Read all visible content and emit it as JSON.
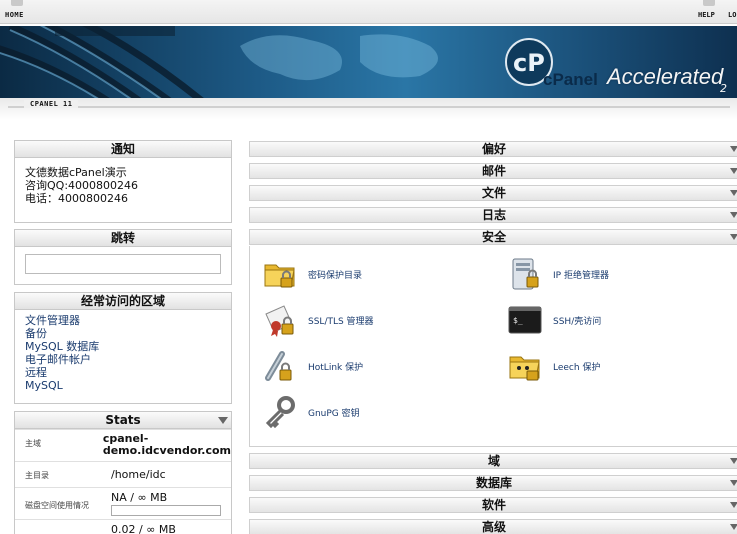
{
  "topbar": {
    "home": "HOME",
    "help": "HELP",
    "logout": "LO"
  },
  "banner": {
    "cpanel": "cPanel",
    "accelerated": "Accelerated",
    "version": "2"
  },
  "breadcrumb": "CPANEL 11",
  "notice": {
    "title": "通知",
    "lines": [
      "文德数据cPanel演示",
      "咨询QQ:4000800246",
      "电话：4000800246"
    ]
  },
  "jump": {
    "title": "跳转",
    "value": ""
  },
  "favorites": {
    "title": "经常访问的区域",
    "items": [
      "文件管理器",
      "备份",
      "MySQL 数据库",
      "电子邮件帐户",
      "远程",
      "MySQL"
    ]
  },
  "stats": {
    "title": "Stats",
    "rows": [
      {
        "key": "主域",
        "value": "cpanel-demo.idcvendor.com"
      },
      {
        "key": "主目录",
        "value": "/home/idc"
      },
      {
        "key": "磁盘空间使用情况",
        "value": "NA / ∞ MB"
      },
      {
        "key": "",
        "value": "0.02 / ∞ MB"
      }
    ]
  },
  "sections": {
    "preferences": "偏好",
    "mail": "邮件",
    "files": "文件",
    "logs": "日志",
    "security": "安全",
    "domains": "域",
    "databases": "数据库",
    "software": "软件",
    "advanced": "高级"
  },
  "security_items": [
    {
      "label": "密码保护目录",
      "icon": "folder-lock-icon"
    },
    {
      "label": "IP 拒绝管理器",
      "icon": "server-deny-icon"
    },
    {
      "label": "SSL/TLS 管理器",
      "icon": "certificate-lock-icon"
    },
    {
      "label": "SSH/壳访问",
      "icon": "terminal-icon"
    },
    {
      "label": "HotLink 保护",
      "icon": "link-lock-icon"
    },
    {
      "label": "Leech 保护",
      "icon": "folder-face-lock-icon"
    },
    {
      "label": "GnuPG 密钥",
      "icon": "key-icon"
    }
  ]
}
